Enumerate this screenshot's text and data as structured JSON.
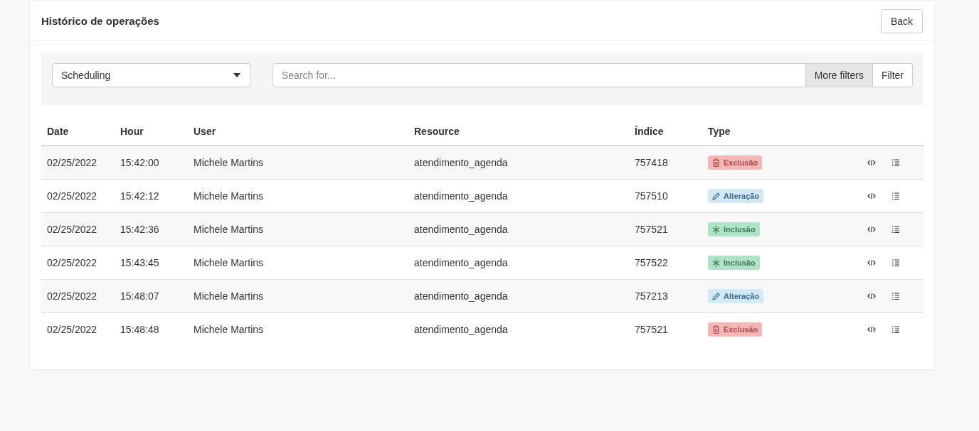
{
  "title": "Histórico de operações",
  "back_button": "Back",
  "filters": {
    "resource_select": "Scheduling",
    "search": {
      "placeholder": "Search for..."
    },
    "more_filters_button": "More filters",
    "filter_button": "Filter"
  },
  "table": {
    "columns": [
      "Date",
      "Hour",
      "User",
      "Resource",
      "Índice",
      "Type"
    ],
    "rows": [
      {
        "date": "02/25/2022",
        "hour": "15:42:00",
        "user": "Michele Martins",
        "resource": "atendimento_agenda",
        "index": "757418",
        "type": {
          "kind": "delete",
          "label": "Exclusão"
        }
      },
      {
        "date": "02/25/2022",
        "hour": "15:42:12",
        "user": "Michele Martins",
        "resource": "atendimento_agenda",
        "index": "757510",
        "type": {
          "kind": "edit",
          "label": "Alteração"
        }
      },
      {
        "date": "02/25/2022",
        "hour": "15:42:36",
        "user": "Michele Martins",
        "resource": "atendimento_agenda",
        "index": "757521",
        "type": {
          "kind": "insert",
          "label": "Inclusão"
        }
      },
      {
        "date": "02/25/2022",
        "hour": "15:43:45",
        "user": "Michele Martins",
        "resource": "atendimento_agenda",
        "index": "757522",
        "type": {
          "kind": "insert",
          "label": "Inclusão"
        }
      },
      {
        "date": "02/25/2022",
        "hour": "15:48:07",
        "user": "Michele Martins",
        "resource": "atendimento_agenda",
        "index": "757213",
        "type": {
          "kind": "edit",
          "label": "Alteração"
        }
      },
      {
        "date": "02/25/2022",
        "hour": "15:48:48",
        "user": "Michele Martins",
        "resource": "atendimento_agenda",
        "index": "757521",
        "type": {
          "kind": "delete",
          "label": "Exclusão"
        }
      }
    ]
  }
}
